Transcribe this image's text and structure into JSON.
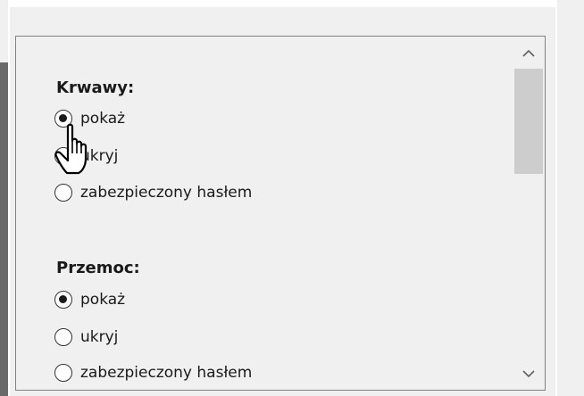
{
  "groups": [
    {
      "title": "Krwawy:",
      "options": [
        {
          "label": "pokaż",
          "checked": true
        },
        {
          "label": "ukryj",
          "checked": false
        },
        {
          "label": "zabezpieczony hasłem",
          "checked": false
        }
      ]
    },
    {
      "title": "Przemoc:",
      "options": [
        {
          "label": "pokaż",
          "checked": true
        },
        {
          "label": "ukryj",
          "checked": false
        },
        {
          "label": "zabezpieczony hasłem",
          "checked": false
        }
      ]
    }
  ],
  "scrollbar": {
    "up_icon": "chevron-up-icon",
    "down_icon": "chevron-down-icon",
    "up_glyph": "︿",
    "down_glyph": "﹀"
  },
  "cursor_icon": "hand-pointer-icon"
}
